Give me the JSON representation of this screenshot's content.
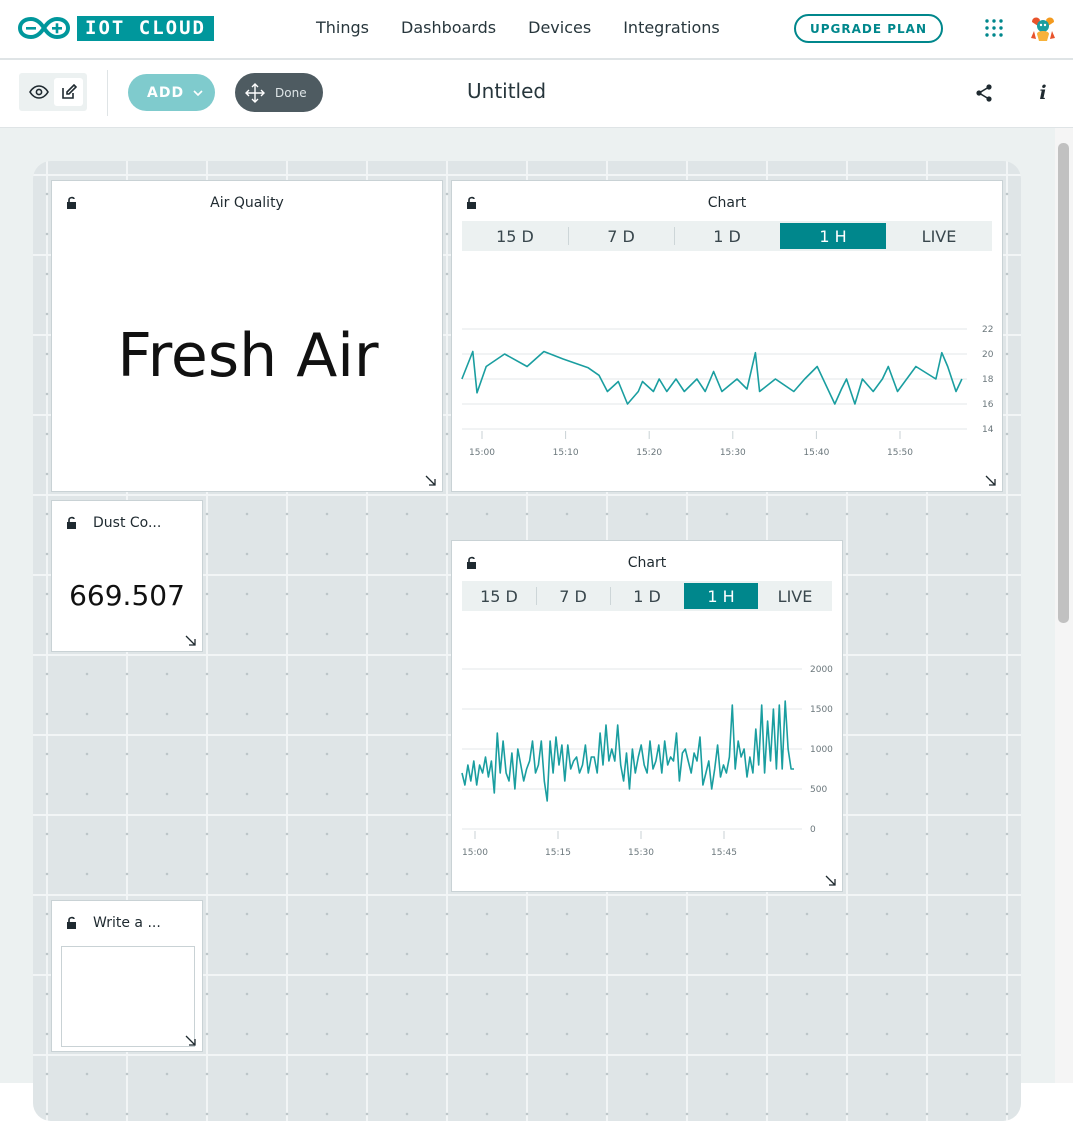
{
  "header": {
    "logo_text": "IOT CLOUD",
    "nav": [
      "Things",
      "Dashboards",
      "Devices",
      "Integrations"
    ],
    "upgrade_label": "UPGRADE PLAN",
    "icons": [
      "apps-grid-icon",
      "user-avatar"
    ]
  },
  "toolbar": {
    "add_label": "ADD",
    "done_label": "Done",
    "dashboard_title": "Untitled",
    "icons": [
      "eye-icon",
      "edit-icon",
      "chevron-down-icon",
      "move-icon",
      "share-icon",
      "info-icon"
    ]
  },
  "colors": {
    "accent": "#00878c",
    "line": "#1a9ea0",
    "add_button": "#7fcbcd",
    "done_button": "#4e5b61"
  },
  "widgets": {
    "air_quality": {
      "title": "Air Quality",
      "value": "Fresh Air"
    },
    "chart1": {
      "title": "Chart",
      "ranges": [
        "15 D",
        "7 D",
        "1 D",
        "1 H",
        "LIVE"
      ],
      "active_range": "1 H"
    },
    "dust": {
      "title": "Dust Co...",
      "value": "669.507"
    },
    "chart2": {
      "title": "Chart",
      "ranges": [
        "15 D",
        "7 D",
        "1 D",
        "1 H",
        "LIVE"
      ],
      "active_range": "1 H"
    },
    "message": {
      "title": "Write a ..."
    }
  },
  "chart_data": [
    {
      "type": "line",
      "title": "Chart",
      "x_ticks": [
        "15:00",
        "15:10",
        "15:20",
        "15:30",
        "15:40",
        "15:50"
      ],
      "y_ticks": [
        "22",
        "20",
        "18",
        "16",
        "14"
      ],
      "ylim": [
        14,
        22
      ],
      "grid": true,
      "x_minutes": [
        -2.4,
        -1.1,
        -0.6,
        0.5,
        2.7,
        5.4,
        7.4,
        9.7,
        12.7,
        14.0,
        15.0,
        16.3,
        17.4,
        18.7,
        19.2,
        20.5,
        21.2,
        22.1,
        23.2,
        24.2,
        25.7,
        26.7,
        27.7,
        28.7,
        30.5,
        31.7,
        32.7,
        33.2,
        35.1,
        37.3,
        38.6,
        40.1,
        42.2,
        43.0,
        43.6,
        44.6,
        45.5,
        46.8,
        47.9,
        48.6,
        49.7,
        51.9,
        54.3,
        55.0,
        55.7,
        56.7,
        57.4
      ],
      "values": [
        18.0,
        20.2,
        16.9,
        19.0,
        20.0,
        19.0,
        20.2,
        19.6,
        18.9,
        18.3,
        17.0,
        17.8,
        16.0,
        17.0,
        17.8,
        17.0,
        18.0,
        17.0,
        18.0,
        17.0,
        18.0,
        17.0,
        18.6,
        17.0,
        18.0,
        17.2,
        20.1,
        17.0,
        18.0,
        17.0,
        18.0,
        19.0,
        16.0,
        17.2,
        18.0,
        16.0,
        18.0,
        17.0,
        18.0,
        19.0,
        17.0,
        19.0,
        18.0,
        20.1,
        19.0,
        17.0,
        18.0
      ],
      "legend": "none"
    },
    {
      "type": "line",
      "title": "Chart",
      "x_ticks": [
        "15:00",
        "15:15",
        "15:30",
        "15:45"
      ],
      "y_ticks": [
        "2000",
        "1500",
        "1000",
        "500",
        "0"
      ],
      "ylim": [
        0,
        2000
      ],
      "grid": true,
      "values": [
        700,
        550,
        800,
        600,
        850,
        550,
        800,
        700,
        900,
        650,
        850,
        450,
        1200,
        700,
        1100,
        700,
        600,
        950,
        500,
        1000,
        800,
        600,
        750,
        850,
        1100,
        700,
        800,
        1100,
        600,
        350,
        1100,
        700,
        1150,
        800,
        1050,
        600,
        1050,
        750,
        850,
        900,
        700,
        800,
        1050,
        700,
        900,
        900,
        700,
        1200,
        800,
        1300,
        850,
        1000,
        850,
        1300,
        800,
        600,
        950,
        500,
        1000,
        700,
        900,
        1050,
        800,
        700,
        1100,
        750,
        850,
        1050,
        700,
        1100,
        800,
        900,
        850,
        1200,
        600,
        950,
        1000,
        850,
        700,
        950,
        850,
        1150,
        550,
        700,
        850,
        500,
        750,
        1050,
        650,
        800,
        700,
        900,
        1550,
        750,
        1100,
        900,
        1000,
        650,
        900,
        700,
        1250,
        800,
        1550,
        700,
        1350,
        850,
        1500,
        750,
        1550,
        750,
        1600,
        1000,
        750,
        750
      ]
    }
  ]
}
